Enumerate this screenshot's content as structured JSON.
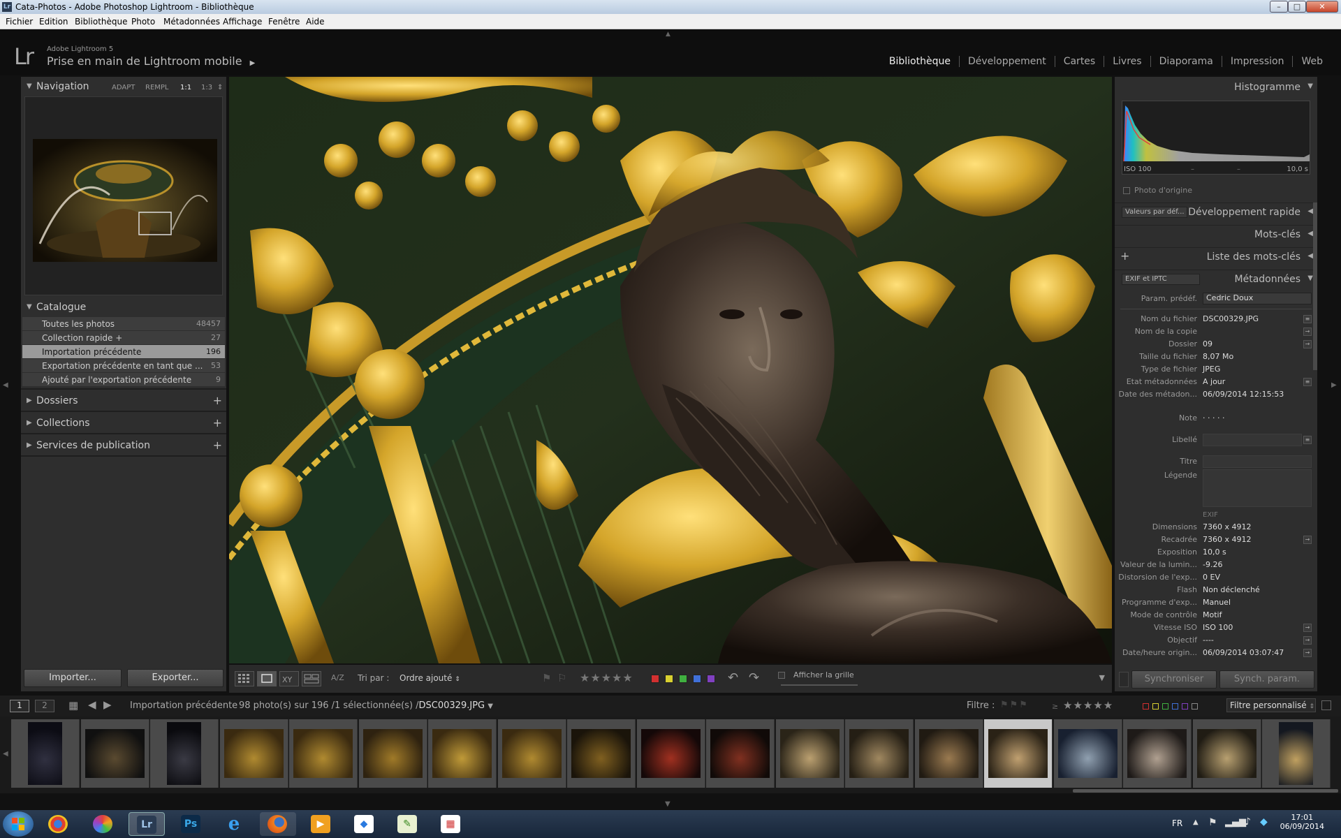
{
  "window": {
    "title": "Cata-Photos - Adobe Photoshop Lightroom - Bibliothèque",
    "app_icon": "Lr",
    "btn_min": "–",
    "btn_max": "□",
    "btn_close": "✕"
  },
  "menu": [
    "Fichier",
    "Edition",
    "Bibliothèque",
    "Photo",
    "Métadonnées",
    "Affichage",
    "Fenêtre",
    "Aide"
  ],
  "appbar": {
    "logo": "Lr",
    "product": "Adobe Lightroom 5",
    "identity": "Prise en main de Lightroom mobile",
    "identity_arrow": "▶",
    "modules": [
      "Bibliothèque",
      "Développement",
      "Cartes",
      "Livres",
      "Diaporama",
      "Impression",
      "Web"
    ],
    "active_module": "Bibliothèque"
  },
  "left": {
    "navigator": {
      "title": "Navigation",
      "zoom": [
        "ADAPT",
        "REMPL",
        "1:1",
        "1:3"
      ],
      "zoom_arrows": "⇕"
    },
    "catalog": {
      "title": "Catalogue",
      "rows": [
        {
          "name": "Toutes les photos",
          "count": "48457"
        },
        {
          "name": "Collection rapide +",
          "count": "27"
        },
        {
          "name": "Importation précédente",
          "count": "196"
        },
        {
          "name": "Exportation précédente en tant que ...",
          "count": "53"
        },
        {
          "name": "Ajouté par l'exportation précédente",
          "count": "9"
        }
      ]
    },
    "folders": "Dossiers",
    "collections": "Collections",
    "publish": "Services de publication",
    "import_btn": "Importer...",
    "export_btn": "Exporter..."
  },
  "toolbar": {
    "sort_label": "Tri par :",
    "sort_value": "Ordre ajouté",
    "sort_icon": "A/Z",
    "stars": "★★★★★",
    "grid_label": "Afficher la grille",
    "colors": [
      "#d23030",
      "#d8d030",
      "#40b040",
      "#4070d8",
      "#8040c0"
    ]
  },
  "right": {
    "histogram": {
      "title": "Histogramme",
      "iso": "ISO 100",
      "dash1": "–",
      "dash2": "–",
      "shutter": "10,0 s",
      "original": "Photo d'origine"
    },
    "quick_dev": {
      "preset": "Valeurs par déf...",
      "title": "Développement rapide"
    },
    "keywords": "Mots-clés",
    "keyword_list": "Liste des mots-clés",
    "metadata": {
      "preset_dd": "EXIF et IPTC",
      "title": "Métadonnées",
      "preset_label": "Param. prédéf.",
      "preset_value": "Cedric Doux",
      "rows": [
        {
          "label": "Nom du fichier",
          "value": "DSC00329.JPG"
        },
        {
          "label": "Nom de la copie",
          "value": ""
        },
        {
          "label": "Dossier",
          "value": "09"
        },
        {
          "label": "Taille du fichier",
          "value": "8,07 Mo"
        },
        {
          "label": "Type de fichier",
          "value": "JPEG"
        },
        {
          "label": "Etat métadonnées",
          "value": "A jour"
        },
        {
          "label": "Date des métadon...",
          "value": "06/09/2014 12:15:53"
        }
      ],
      "note_label": "Note",
      "note_value": "·  ·  ·  ·  ·",
      "label_label": "Libellé",
      "title_label": "Titre",
      "caption_label": "Légende",
      "exif_header": "EXIF",
      "exif_rows": [
        {
          "label": "Dimensions",
          "value": "7360 x 4912"
        },
        {
          "label": "Recadrée",
          "value": "7360 x 4912"
        },
        {
          "label": "Exposition",
          "value": "10,0 s"
        },
        {
          "label": "Valeur de la lumin...",
          "value": "-9.26"
        },
        {
          "label": "Distorsion de l'exp...",
          "value": "0 EV"
        },
        {
          "label": "Flash",
          "value": "Non déclenché"
        },
        {
          "label": "Programme d'exp...",
          "value": "Manuel"
        },
        {
          "label": "Mode de contrôle",
          "value": "Motif"
        },
        {
          "label": "Vitesse ISO",
          "value": "ISO 100"
        },
        {
          "label": "Objectif",
          "value": "----"
        },
        {
          "label": "Date/heure origin...",
          "value": "06/09/2014 03:07:47"
        }
      ]
    },
    "sync_btn": "Synchroniser",
    "sync_params_btn": "Synch. param."
  },
  "filmhead": {
    "view1": "1",
    "view2": "2",
    "source": "Importation précédente",
    "count_info": "98 photo(s) sur 196 /1 sélectionnée(s) /",
    "filename": "DSC00329.JPG",
    "filter_label": "Filtre :",
    "filter_stars": "★★★★★",
    "filter_value": "Filtre personnalisé"
  },
  "taskbar": {
    "lang": "FR",
    "time": "17:01",
    "date": "06/09/2014",
    "apps": [
      "chrome",
      "picasa",
      "lightroom",
      "photoshop",
      "internet-explorer",
      "firefox",
      "media-player",
      "dropbox",
      "notepad",
      "app-grid"
    ],
    "lr_label": "Lr",
    "ps_label": "Ps"
  }
}
